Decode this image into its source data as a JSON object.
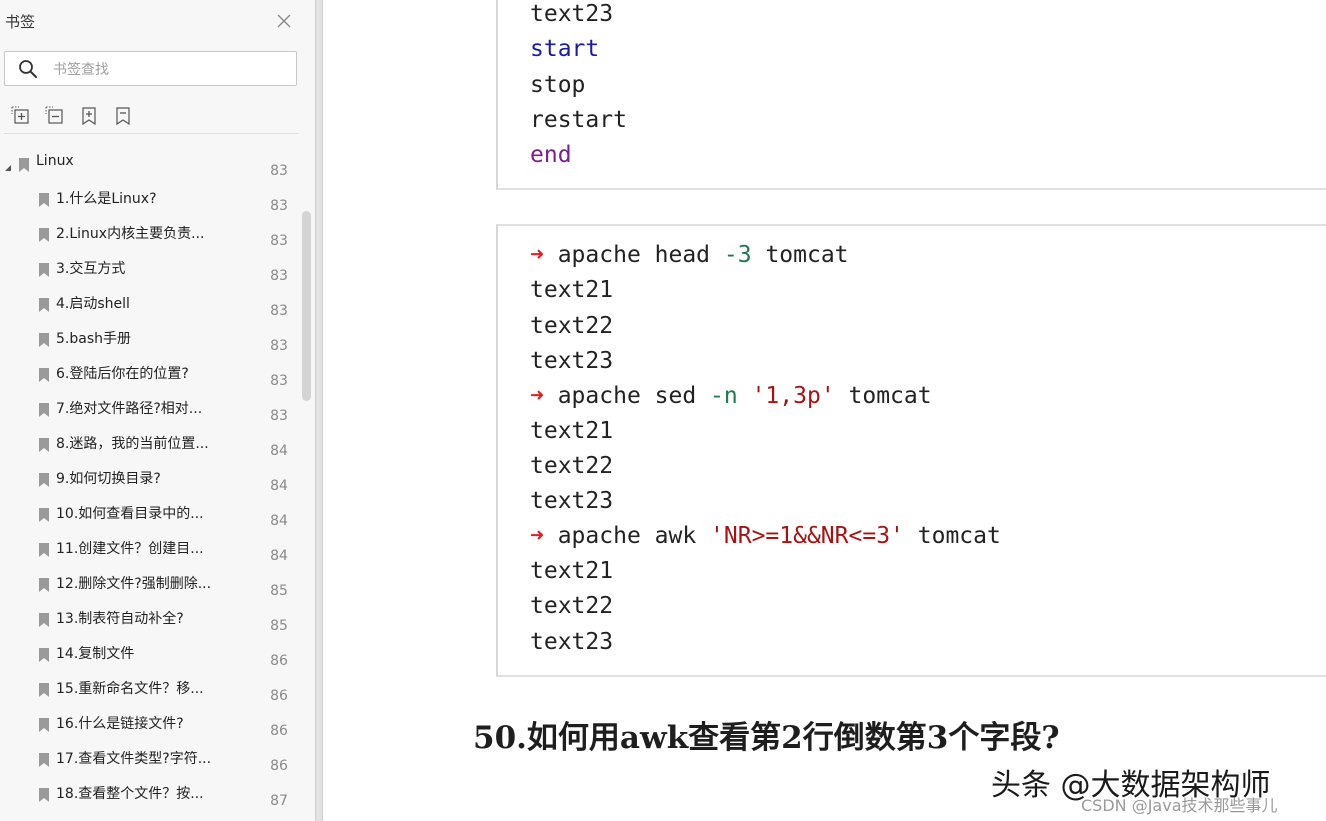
{
  "sidebar": {
    "title": "书签",
    "search_placeholder": "书签查找",
    "tools": [
      "expand-all-icon",
      "collapse-all-icon",
      "add-bookmark-icon",
      "bookmark-icon"
    ],
    "root": {
      "label": "Linux",
      "page": "83"
    },
    "items": [
      {
        "label": "1.什么是Linux?",
        "page": "83"
      },
      {
        "label": "2.Linux内核主要负责...",
        "page": "83"
      },
      {
        "label": "3.交互方式",
        "page": "83"
      },
      {
        "label": "4.启动shell",
        "page": "83"
      },
      {
        "label": "5.bash手册",
        "page": "83"
      },
      {
        "label": "6.登陆后你在的位置?",
        "page": "83"
      },
      {
        "label": "7.绝对文件路径?相对...",
        "page": "83"
      },
      {
        "label": "8.迷路，我的当前位置...",
        "page": "84"
      },
      {
        "label": "9.如何切换目录?",
        "page": "84"
      },
      {
        "label": "10.如何查看目录中的...",
        "page": "84"
      },
      {
        "label": "11.创建文件？创建目...",
        "page": "84"
      },
      {
        "label": "12.删除文件?强制删除...",
        "page": "85"
      },
      {
        "label": "13.制表符自动补全?",
        "page": "85"
      },
      {
        "label": "14.复制文件",
        "page": "86"
      },
      {
        "label": "15.重新命名文件？移...",
        "page": "86"
      },
      {
        "label": "16.什么是链接文件?",
        "page": "86"
      },
      {
        "label": "17.查看文件类型?字符...",
        "page": "86"
      },
      {
        "label": "18.查看整个文件？按...",
        "page": "87"
      }
    ]
  },
  "document": {
    "block1": {
      "line1": "text23",
      "line2": "start",
      "line3": "stop",
      "line4": "restart",
      "line5": "end"
    },
    "block2": {
      "cmd1": {
        "arrow": "➜",
        "dir": " apache ",
        "cmd": "head ",
        "opt": "-3",
        "rest": " tomcat"
      },
      "cmd1_out": [
        "text21",
        "text22",
        "text23"
      ],
      "cmd2": {
        "arrow": "➜",
        "dir": " apache ",
        "cmd": "sed ",
        "opt": "-n",
        "str": " '1,3p'",
        "rest": " tomcat"
      },
      "cmd2_out": [
        "text21",
        "text22",
        "text23"
      ],
      "cmd3": {
        "arrow": "➜",
        "dir": " apache ",
        "cmd": "awk ",
        "str": "'NR>=1&&NR<=3'",
        "rest": " tomcat"
      },
      "cmd3_out": [
        "text21",
        "text22",
        "text23"
      ]
    },
    "heading": "50.如何用awk查看第2行倒数第3个字段?",
    "watermark_main": "头条 @大数据架构师",
    "watermark_sub": "CSDN @Java技术那些事儿"
  },
  "colors": {
    "keyword_blue": "#1a1aa6",
    "keyword_purple": "#7a1f8c",
    "prompt_arrow": "#e02020",
    "option_green": "#1b7a50",
    "string_red": "#a31515"
  }
}
